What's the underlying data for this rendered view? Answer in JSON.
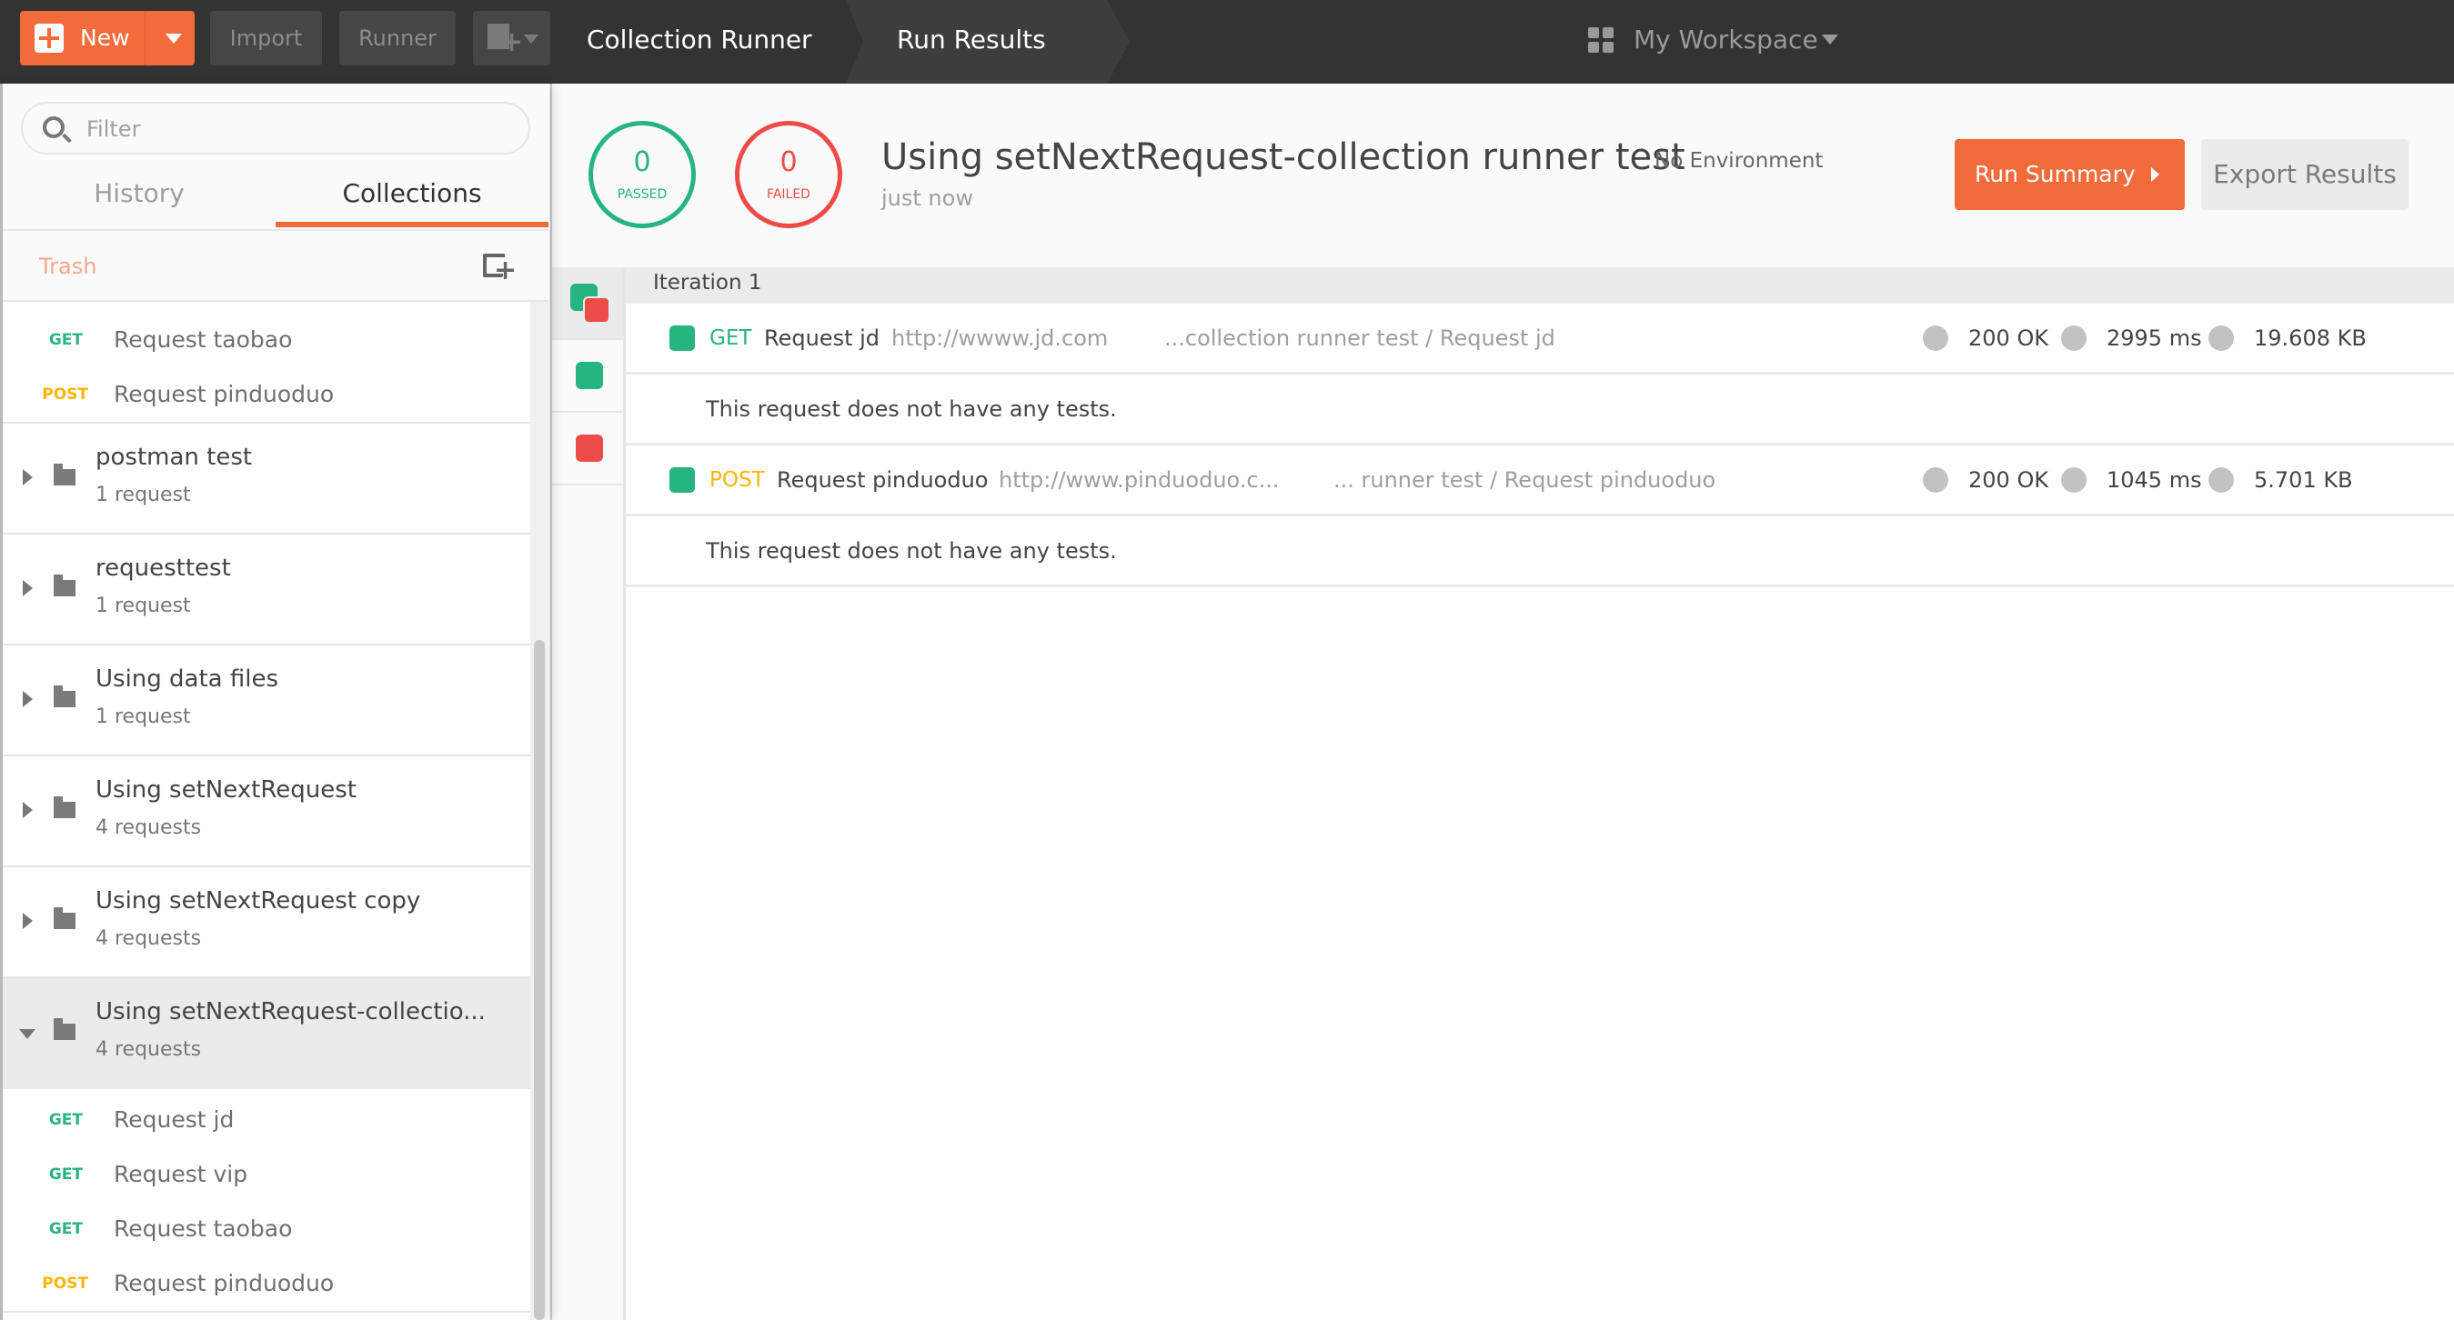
{
  "topbar": {
    "new_label": "New",
    "import_label": "Import",
    "runner_label": "Runner",
    "tabs": [
      {
        "label": "Collection Runner"
      },
      {
        "label": "Run Results"
      }
    ],
    "workspace_label": "My Workspace"
  },
  "sidebar": {
    "filter_placeholder": "Filter",
    "tabs": [
      {
        "label": "History"
      },
      {
        "label": "Collections"
      }
    ],
    "trash_label": "Trash",
    "top_requests": [
      {
        "method": "GET",
        "name": "Request taobao"
      },
      {
        "method": "POST",
        "name": "Request pinduoduo"
      }
    ],
    "collections": [
      {
        "name": "postman test",
        "count": "1 request"
      },
      {
        "name": "requesttest",
        "count": "1 request"
      },
      {
        "name": "Using data files",
        "count": "1 request"
      },
      {
        "name": "Using setNextRequest",
        "count": "4 requests"
      },
      {
        "name": "Using setNextRequest copy",
        "count": "4 requests"
      },
      {
        "name": "Using setNextRequest-collectio...",
        "count": "4 requests"
      }
    ],
    "expanded_requests": [
      {
        "method": "GET",
        "name": "Request jd"
      },
      {
        "method": "GET",
        "name": "Request vip"
      },
      {
        "method": "GET",
        "name": "Request taobao"
      },
      {
        "method": "POST",
        "name": "Request pinduoduo"
      }
    ]
  },
  "summary": {
    "passed": {
      "value": "0",
      "label": "PASSED"
    },
    "failed": {
      "value": "0",
      "label": "FAILED"
    },
    "title": "Using setNextRequest-collection runner test",
    "environment": "No Environment",
    "time": "just now",
    "run_summary_label": "Run Summary",
    "export_label": "Export Results"
  },
  "results": {
    "iteration_label": "Iteration 1",
    "no_tests_text": "This request does not have any tests.",
    "requests": [
      {
        "method": "GET",
        "name": "Request jd",
        "url": "http://wwww.jd.com",
        "path": "...collection runner test / Request jd",
        "status": "200 OK",
        "time": "2995 ms",
        "size": "19.608 KB"
      },
      {
        "method": "POST",
        "name": "Request pinduoduo",
        "url": "http://www.pinduoduo.c...",
        "path": "... runner test / Request pinduoduo",
        "status": "200 OK",
        "time": "1045 ms",
        "size": "5.701 KB"
      }
    ]
  },
  "colors": {
    "accent": "#f26b3a",
    "pass": "#26b47f",
    "fail": "#ed4b48",
    "get": "#26b47f",
    "post": "#ffb400"
  }
}
